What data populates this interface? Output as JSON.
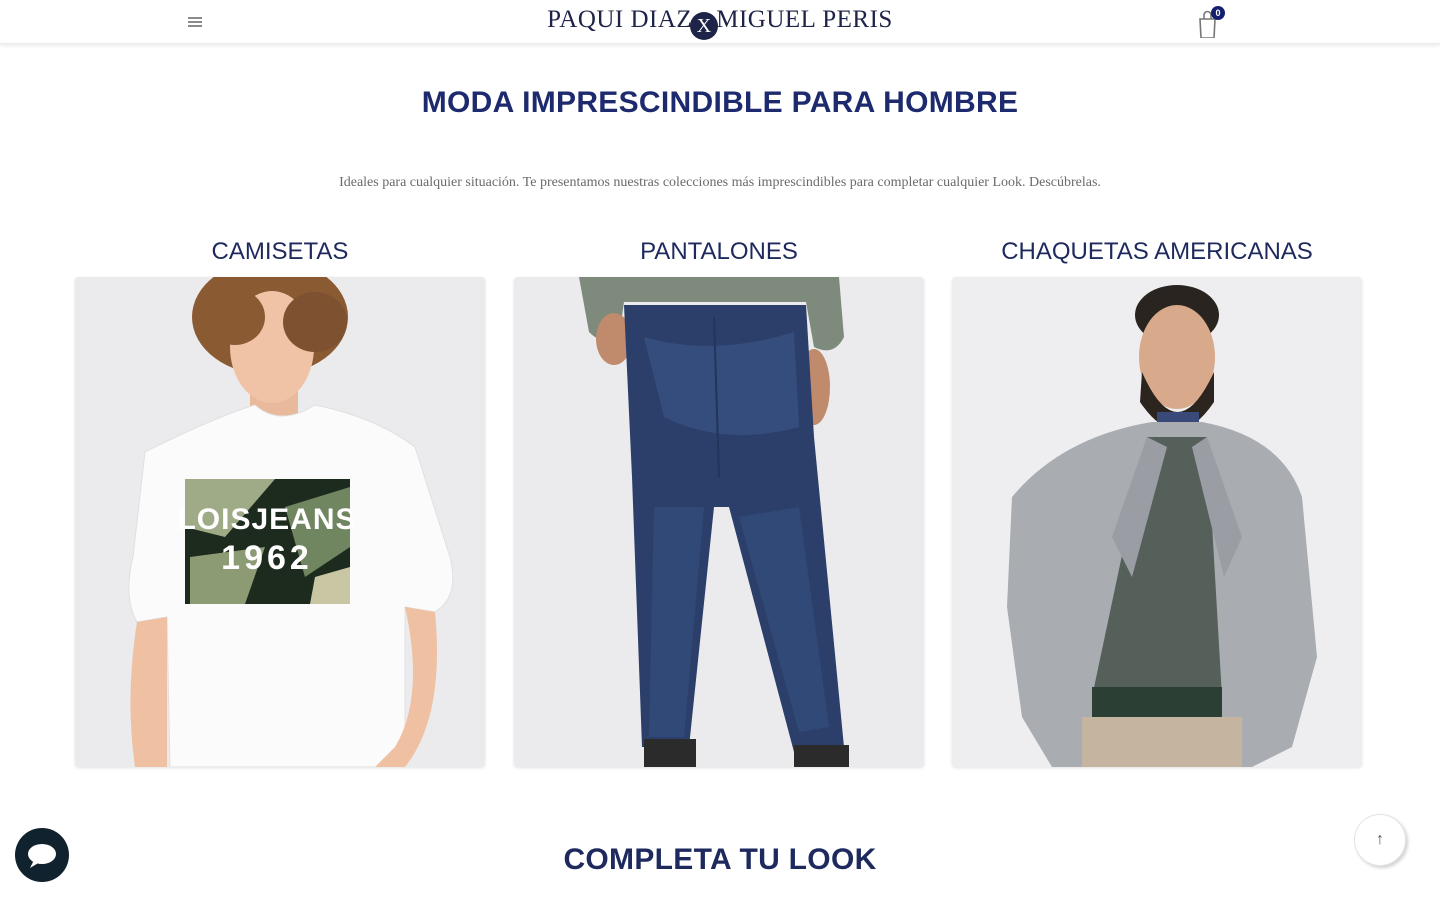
{
  "header": {
    "logo_left": "PAQUI DIAZ",
    "logo_mark": "X",
    "logo_right": "MIGUEL PERIS",
    "cart_count": "0",
    "menu_icon": "hamburger-icon",
    "cart_icon": "shopping-bag-icon"
  },
  "main": {
    "title": "MODA IMPRESCINDIBLE PARA HOMBRE",
    "subtitle": "Ideales para cualquier situación. Te presentamos nuestras colecciones más imprescindibles para completar cualquier Look. Descúbrelas.",
    "categories": [
      {
        "label": "CAMISETAS",
        "print_top": "LOISJEANS",
        "print_bottom": "1962"
      },
      {
        "label": "PANTALONES"
      },
      {
        "label": "CHAQUETAS AMERICANAS"
      }
    ],
    "next_section_title": "COMPLETA TU LOOK"
  },
  "widgets": {
    "chat_icon": "chat-bubble-icon",
    "scroll_top_label": "↑"
  },
  "colors": {
    "brand_navy": "#1e2a6e",
    "badge": "#14206e",
    "chat_button": "#10222e"
  }
}
